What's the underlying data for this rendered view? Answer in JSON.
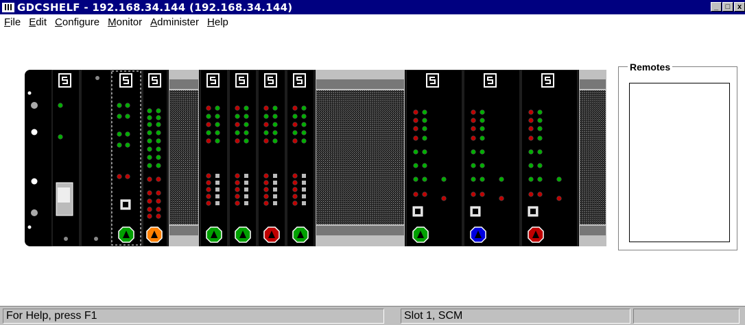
{
  "window": {
    "title": "GDCSHELF - 192.168.34.144 (192.168.34.144)",
    "minimize_glyph": "_",
    "restore_glyph": "□",
    "close_glyph": "x"
  },
  "menu": [
    "File",
    "Edit",
    "Configure",
    "Monitor",
    "Administer",
    "Help"
  ],
  "remotes": {
    "label": "Remotes",
    "items": []
  },
  "status": {
    "help": "For Help, press F1",
    "slot": "Slot 1, SCM",
    "extra": ""
  },
  "colors": {
    "title_bg": "#000080",
    "green_alarm": "#00a000",
    "orange_alarm": "#ff8000",
    "red_alarm": "#c00000",
    "blue_alarm": "#0000e0",
    "led_green": "#00b000",
    "led_red": "#c00000"
  },
  "cards": [
    {
      "id": "slot-scm",
      "logo": "G",
      "leds": [
        "g",
        "g"
      ],
      "switch": true,
      "alarm": ""
    },
    {
      "id": "slot-narrow",
      "logo": "",
      "leds": [],
      "switch": false,
      "alarm": ""
    },
    {
      "id": "slot-1",
      "logo": "G",
      "selected": true,
      "alarm": "green",
      "port": true
    },
    {
      "id": "slot-2",
      "logo": "G",
      "alarm": "orange",
      "port": false
    },
    {
      "id": "slot-blank-1",
      "blank": true
    },
    {
      "id": "slot-3",
      "logo": "G",
      "alarm": "green"
    },
    {
      "id": "slot-4",
      "logo": "G",
      "alarm": "green"
    },
    {
      "id": "slot-5",
      "logo": "G",
      "alarm": "red"
    },
    {
      "id": "slot-6",
      "logo": "G",
      "alarm": "green"
    },
    {
      "id": "slot-blank-2",
      "blank": true
    },
    {
      "id": "slot-7",
      "logo": "G",
      "alarm": "green",
      "port": true
    },
    {
      "id": "slot-8",
      "logo": "G",
      "alarm": "blue",
      "port": true
    },
    {
      "id": "slot-9",
      "logo": "G",
      "alarm": "red",
      "port": true
    },
    {
      "id": "slot-blank-3",
      "blank": true
    }
  ]
}
